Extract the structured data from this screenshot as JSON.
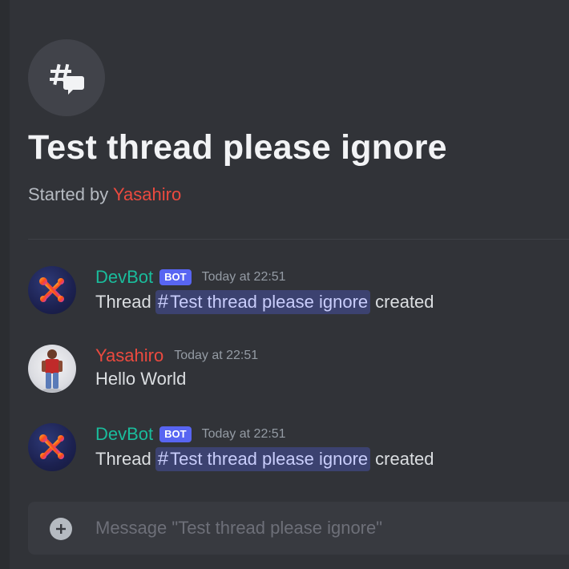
{
  "thread": {
    "title": "Test thread please ignore",
    "started_by_prefix": "Started by",
    "starter": "Yasahiro"
  },
  "messages": [
    {
      "author": "DevBot",
      "bot_tag": "BOT",
      "timestamp": "Today at 22:51",
      "text_before": "Thread",
      "mention": "Test thread please ignore",
      "text_after": "created"
    },
    {
      "author": "Yasahiro",
      "timestamp": "Today at 22:51",
      "text": "Hello World"
    },
    {
      "author": "DevBot",
      "bot_tag": "BOT",
      "timestamp": "Today at 22:51",
      "text_before": "Thread",
      "mention": "Test thread please ignore",
      "text_after": "created"
    }
  ],
  "composer": {
    "placeholder": "Message \"Test thread please ignore\""
  },
  "icons": {
    "thread_header": "thread-hash-icon",
    "mention": "hash-icon",
    "add": "plus-circle-icon",
    "bot_avatar": "tools-icon"
  },
  "colors": {
    "background": "#313338",
    "bot_name": "#1abc9c",
    "user_name": "#ec4a3f",
    "bot_tag": "#5865f2",
    "mention_bg": "#3c4270",
    "mention_text": "#c9cdfb"
  }
}
